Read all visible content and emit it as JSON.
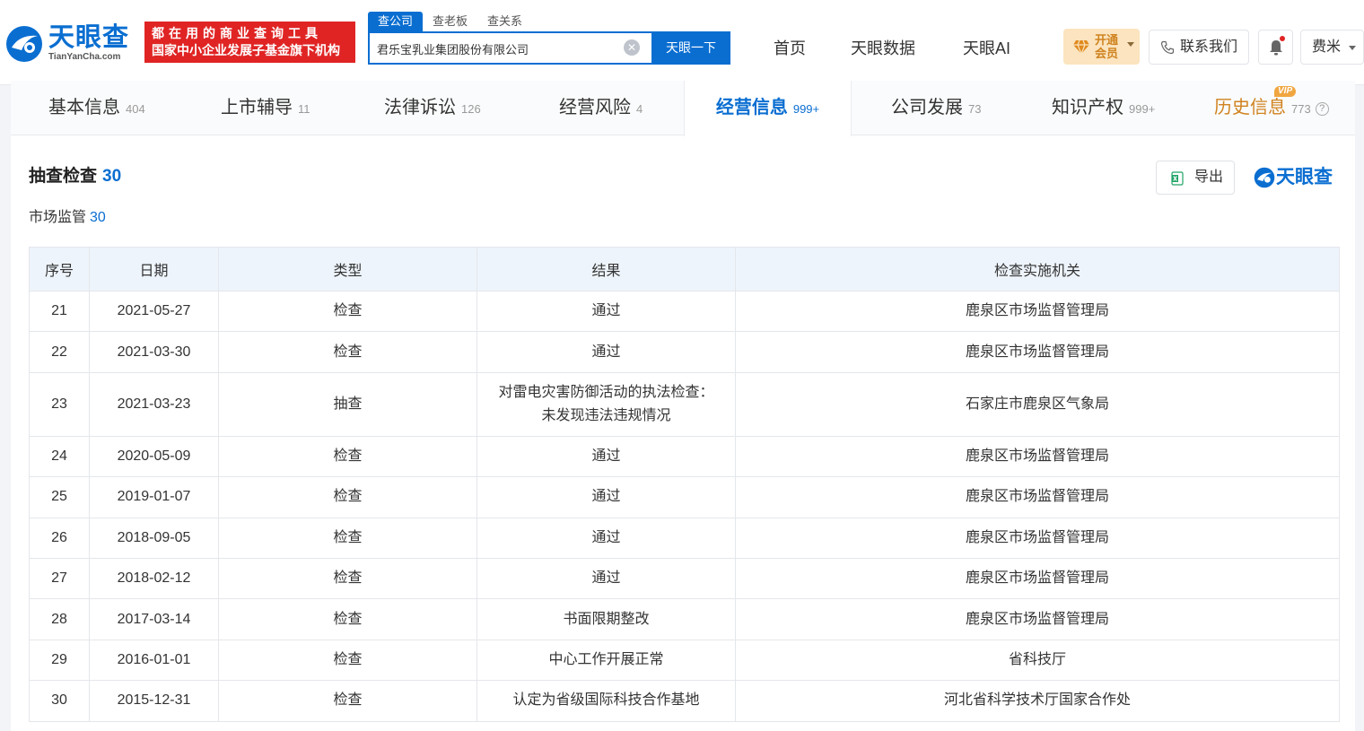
{
  "header": {
    "logo_cn": "天眼查",
    "logo_en": "TianYanCha.com",
    "slogan_line1": "都在用的商业查询工具",
    "slogan_line2": "国家中小企业发展子基金旗下机构",
    "search_tabs": [
      "查公司",
      "查老板",
      "查关系"
    ],
    "search_value": "君乐宝乳业集团股份有限公司",
    "search_button": "天眼一下",
    "nav": [
      "首页",
      "天眼数据",
      "天眼AI"
    ],
    "vip_label": "开通会员",
    "contact_label": "联系我们",
    "user_name": "费米"
  },
  "tabs": [
    {
      "label": "基本信息",
      "count": "404"
    },
    {
      "label": "上市辅导",
      "count": "11"
    },
    {
      "label": "法律诉讼",
      "count": "126"
    },
    {
      "label": "经营风险",
      "count": "4"
    },
    {
      "label": "经营信息",
      "count": "999+"
    },
    {
      "label": "公司发展",
      "count": "73"
    },
    {
      "label": "知识产权",
      "count": "999+"
    },
    {
      "label": "历史信息",
      "count": "773"
    }
  ],
  "vip_tag": "VIP",
  "help_icon": "?",
  "section": {
    "title": "抽查检查",
    "count": "30",
    "sub_label": "市场监管",
    "sub_count": "30",
    "export_label": "导出",
    "brand": "天眼查"
  },
  "table": {
    "headers": [
      "序号",
      "日期",
      "类型",
      "结果",
      "检查实施机关"
    ],
    "rows": [
      {
        "no": "21",
        "date": "2021-05-27",
        "type": "检查",
        "result": "通过",
        "result2": "",
        "agency": "鹿泉区市场监督管理局"
      },
      {
        "no": "22",
        "date": "2021-03-30",
        "type": "检查",
        "result": "通过",
        "result2": "",
        "agency": "鹿泉区市场监督管理局"
      },
      {
        "no": "23",
        "date": "2021-03-23",
        "type": "抽查",
        "result": "对雷电灾害防御活动的执法检查：",
        "result2": "未发现违法违规情况",
        "agency": "石家庄市鹿泉区气象局"
      },
      {
        "no": "24",
        "date": "2020-05-09",
        "type": "检查",
        "result": "通过",
        "result2": "",
        "agency": "鹿泉区市场监督管理局"
      },
      {
        "no": "25",
        "date": "2019-01-07",
        "type": "检查",
        "result": "通过",
        "result2": "",
        "agency": "鹿泉区市场监督管理局"
      },
      {
        "no": "26",
        "date": "2018-09-05",
        "type": "检查",
        "result": "通过",
        "result2": "",
        "agency": "鹿泉区市场监督管理局"
      },
      {
        "no": "27",
        "date": "2018-02-12",
        "type": "检查",
        "result": "通过",
        "result2": "",
        "agency": "鹿泉区市场监督管理局"
      },
      {
        "no": "28",
        "date": "2017-03-14",
        "type": "检查",
        "result": "书面限期整改",
        "result2": "",
        "agency": "鹿泉区市场监督管理局"
      },
      {
        "no": "29",
        "date": "2016-01-01",
        "type": "检查",
        "result": "中心工作开展正常",
        "result2": "",
        "agency": "省科技厅"
      },
      {
        "no": "30",
        "date": "2015-12-31",
        "type": "检查",
        "result": "认定为省级国际科技合作基地",
        "result2": "",
        "agency": "河北省科学技术厅国家合作处"
      }
    ]
  },
  "colors": {
    "brand_blue": "#0a6ed1",
    "slogan_red": "#e02424",
    "vip_gold": "#d0831f"
  },
  "icons": [
    "tianyancha-logo-icon",
    "clear-icon",
    "gem-icon",
    "phone-icon",
    "bell-icon",
    "excel-icon",
    "help-icon"
  ]
}
